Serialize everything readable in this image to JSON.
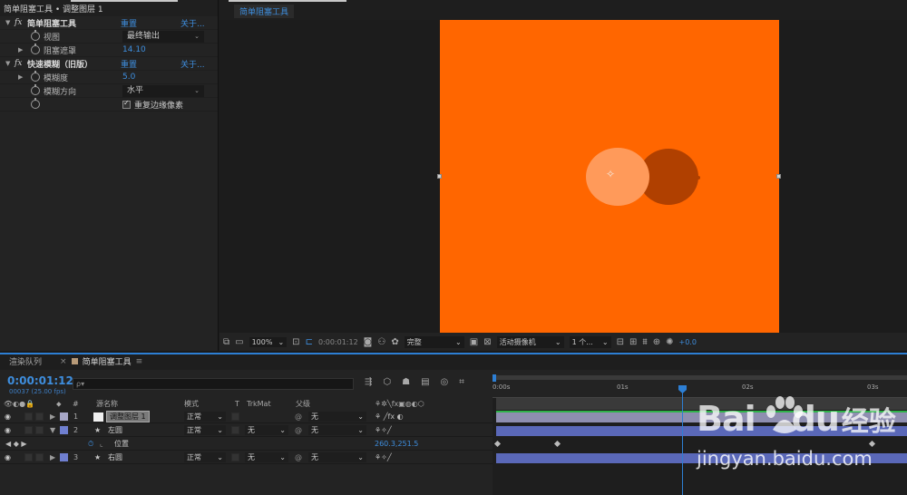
{
  "effect_panel": {
    "breadcrumb": "简单阻塞工具 • 调整图层 1",
    "effects": [
      {
        "name": "简单阻塞工具",
        "reset": "重置",
        "about": "关于...",
        "params": [
          {
            "label": "视图",
            "type": "dropdown",
            "value": "最终输出"
          },
          {
            "label": "阻塞遮罩",
            "type": "number",
            "value": "14.10"
          }
        ]
      },
      {
        "name": "快速模糊（旧版）",
        "reset": "重置",
        "about": "关于...",
        "params": [
          {
            "label": "模糊度",
            "type": "number",
            "value": "5.0"
          },
          {
            "label": "模糊方向",
            "type": "dropdown",
            "value": "水平"
          },
          {
            "label": "",
            "type": "checkbox",
            "value": "重复边缘像素"
          }
        ]
      }
    ]
  },
  "viewer": {
    "comp_tab": "简单阻塞工具",
    "background_color": "#ff6600",
    "zoom": "100%",
    "timecode": "0:00:01:12",
    "quality": "完整",
    "camera": "活动摄像机",
    "views": "1 个...",
    "exposure": "+0.0"
  },
  "timeline": {
    "tabs": {
      "render_queue": "渲染队列",
      "comp": "简单阻塞工具"
    },
    "timecode": "0:00:01:12",
    "frames": "00037 (25.00 fps)",
    "search_placeholder": "ρ▾",
    "columns": {
      "num": "#",
      "source": "源名称",
      "mode": "模式",
      "t": "T",
      "trkmat": "TrkMat",
      "parent": "父级"
    },
    "layers": [
      {
        "num": "1",
        "name": "调整图层 1",
        "mode": "正常",
        "trkmat": "",
        "parent": "无",
        "color": "#a8a8c8",
        "selected": true
      },
      {
        "num": "2",
        "name": "左圆",
        "mode": "正常",
        "trkmat": "无",
        "parent": "无",
        "color": "#6f7fd0",
        "selected": false
      },
      {
        "num": "3",
        "name": "右圆",
        "mode": "正常",
        "trkmat": "无",
        "parent": "无",
        "color": "#6f7fd0",
        "selected": false
      }
    ],
    "property": {
      "name": "位置",
      "value": "260.3,251.5"
    },
    "ruler_labels": [
      "0:00s",
      "01s",
      "02s",
      "03s"
    ]
  },
  "watermark": {
    "brand_left": "Bai",
    "brand_right": "du",
    "brand_cn": "经验",
    "url": "jingyan.baidu.com"
  }
}
